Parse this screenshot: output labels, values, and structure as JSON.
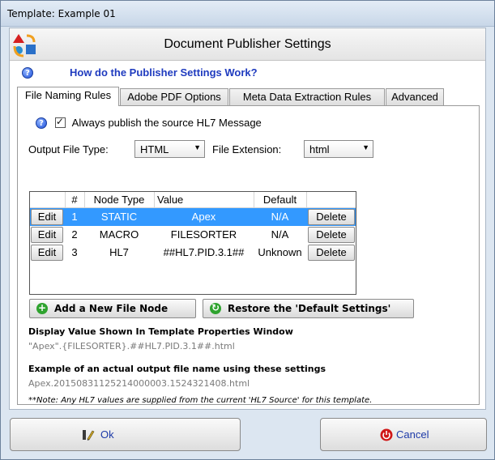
{
  "window": {
    "title": "Template: Example 01"
  },
  "header": {
    "title": "Document Publisher Settings"
  },
  "help": {
    "link_text": "How do the Publisher Settings Work?"
  },
  "tabs": [
    {
      "label": "File Naming Rules",
      "active": true
    },
    {
      "label": "Adobe PDF Options",
      "active": false
    },
    {
      "label": "Meta Data Extraction Rules",
      "active": false
    },
    {
      "label": "Advanced",
      "active": false
    }
  ],
  "publish_option": {
    "label": "Always publish the source HL7 Message",
    "checked": true
  },
  "output": {
    "file_type_label": "Output File Type:",
    "file_type_value": "HTML",
    "extension_label": "File Extension:",
    "extension_value": "html"
  },
  "grid": {
    "columns": [
      "#",
      "Node Type",
      "Value",
      "Default"
    ],
    "rows": [
      {
        "edit": "Edit",
        "num": "1",
        "type": "STATIC",
        "value": "Apex",
        "default": "N/A",
        "delete": "Delete",
        "selected": true
      },
      {
        "edit": "Edit",
        "num": "2",
        "type": "MACRO",
        "value": "FILESORTER",
        "default": "N/A",
        "delete": "Delete",
        "selected": false
      },
      {
        "edit": "Edit",
        "num": "3",
        "type": "HL7",
        "value": "##HL7.PID.3.1##",
        "default": "Unknown",
        "delete": "Delete",
        "selected": false
      }
    ]
  },
  "actions": {
    "add_label": "Add a New File Node",
    "restore_label": "Restore the 'Default Settings'"
  },
  "display": {
    "heading": "Display Value Shown In Template Properties Window",
    "value": "\"Apex\".{FILESORTER}.##HL7.PID.3.1##.html"
  },
  "example": {
    "heading": "Example of an actual output file name using these settings",
    "value": "Apex.20150831125214000003.1524321408.html"
  },
  "note": "**Note: Any HL7 values are supplied from the current 'HL7 Source' for this template.",
  "footer": {
    "ok_label": "Ok",
    "cancel_label": "Cancel"
  },
  "colors": {
    "selected_row": "#3399ff",
    "help_link": "#1f3bbf",
    "add_icon": "#2fa32f",
    "restore_icon": "#2fa32f",
    "cancel_icon": "#d01818"
  },
  "icons": {
    "logo": "shapes-logo-icon",
    "help": "help-icon",
    "add": "plus-circle-icon",
    "restore": "refresh-icon",
    "ok": "edit-pen-icon",
    "cancel": "power-icon"
  }
}
